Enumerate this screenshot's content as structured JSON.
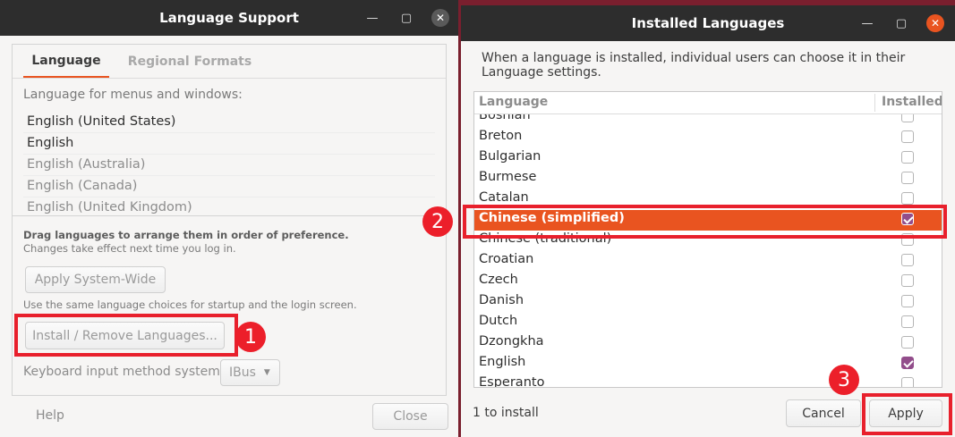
{
  "left_window": {
    "title": "Language Support",
    "tabs": [
      "Language",
      "Regional Formats"
    ],
    "section_label": "Language for menus and windows:",
    "languages": [
      "English (United States)",
      "English",
      "English (Australia)",
      "English (Canada)",
      "English (United Kingdom)"
    ],
    "drag_hint_bold": "Drag languages to arrange them in order of preference.",
    "drag_hint": "Changes take effect next time you log in.",
    "apply_system_wide": "Apply System-Wide",
    "startup_hint": "Use the same language choices for startup and the login screen.",
    "install_remove": "Install / Remove Languages...",
    "keyboard_label": "Keyboard input method system:",
    "keyboard_value": "IBus",
    "help": "Help",
    "close": "Close"
  },
  "right_window": {
    "title": "Installed Languages",
    "description": "When a language is installed, individual users can choose it in their Language settings.",
    "col_language": "Language",
    "col_installed": "Installed",
    "rows": [
      {
        "name": "Bosnian",
        "installed": false
      },
      {
        "name": "Breton",
        "installed": false
      },
      {
        "name": "Bulgarian",
        "installed": false
      },
      {
        "name": "Burmese",
        "installed": false
      },
      {
        "name": "Catalan",
        "installed": false
      },
      {
        "name": "Chinese (simplified)",
        "installed": true
      },
      {
        "name": "Chinese (traditional)",
        "installed": false
      },
      {
        "name": "Croatian",
        "installed": false
      },
      {
        "name": "Czech",
        "installed": false
      },
      {
        "name": "Danish",
        "installed": false
      },
      {
        "name": "Dutch",
        "installed": false
      },
      {
        "name": "Dzongkha",
        "installed": false
      },
      {
        "name": "English",
        "installed": true
      },
      {
        "name": "Esperanto",
        "installed": false
      }
    ],
    "status": "1 to install",
    "cancel": "Cancel",
    "apply": "Apply"
  },
  "annotations": [
    "1",
    "2",
    "3"
  ],
  "colors": {
    "accent": "#e95420",
    "annotation": "#e8202c",
    "checked": "#924d8b",
    "titlebar": "#2d2d2d"
  }
}
